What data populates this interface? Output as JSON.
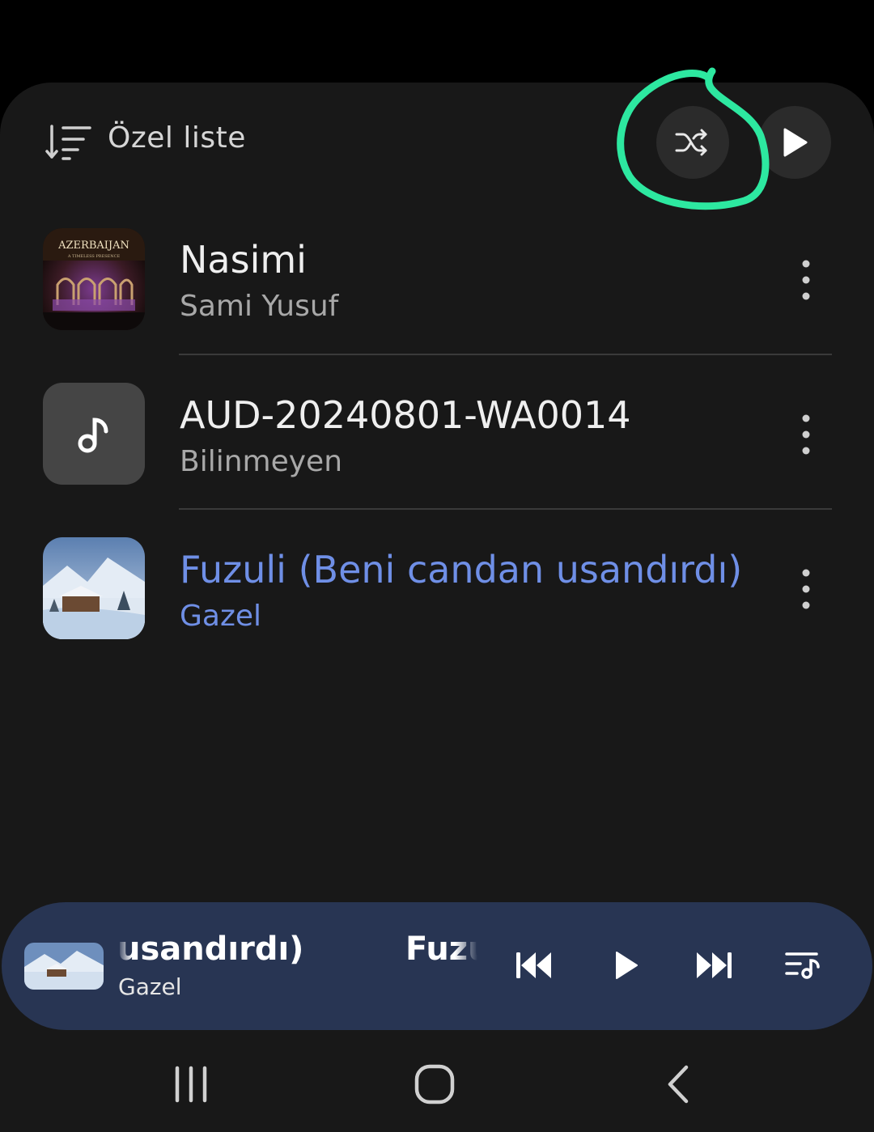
{
  "header": {
    "title": "Özel liste",
    "icons": {
      "sort": "sort-icon",
      "shuffle": "shuffle-icon",
      "play": "play-icon"
    }
  },
  "tracks": [
    {
      "title": "Nasimi",
      "artist": "Sami Yusuf",
      "art": "album-art-azerbaijan",
      "art_text": "AZERBAIJAN",
      "art_subtext": "A TIMELESS PRESENCE",
      "active": false
    },
    {
      "title": "AUD-20240801-WA0014",
      "artist": "Bilinmeyen",
      "art": "music-note-placeholder",
      "active": false
    },
    {
      "title": "Fuzuli (Beni candan usandırdı)",
      "artist": "Gazel",
      "art": "album-art-winter-cabin",
      "active": true
    }
  ],
  "mini_player": {
    "title_visible_a": "usandırdı)",
    "title_visible_b": "Fuzu",
    "artist": "Gazel",
    "controls": [
      "previous-icon",
      "play-icon",
      "next-icon",
      "queue-icon"
    ]
  },
  "navbar": {
    "buttons": [
      "recents-icon",
      "home-icon",
      "back-icon"
    ]
  },
  "colors": {
    "background": "#000000",
    "sheet": "#181818",
    "active_track": "#6f8fe6",
    "mini_player": "#283553",
    "annotation": "#2de8a0"
  }
}
